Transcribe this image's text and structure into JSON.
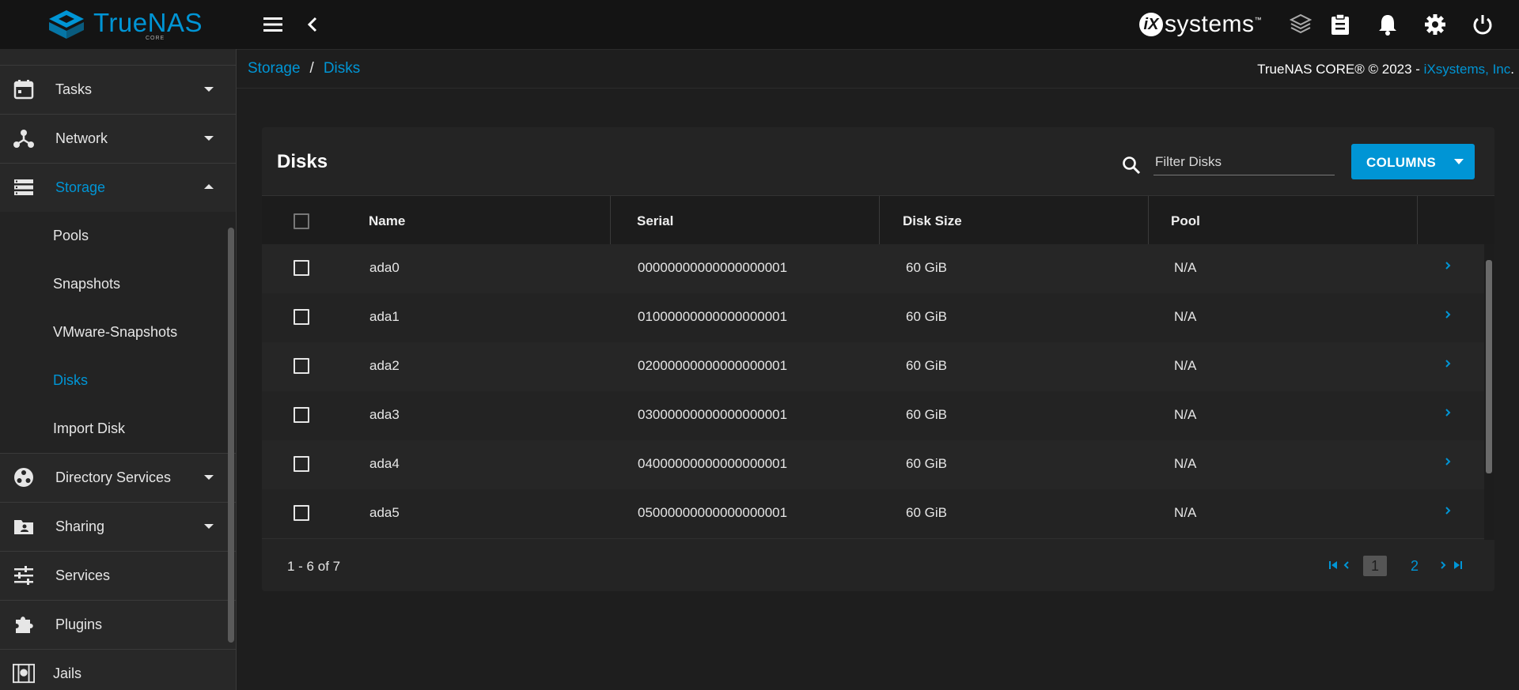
{
  "app": {
    "logo_text": "TrueNAS",
    "logo_sub": "CORE",
    "vendor_logo_mark": "iX",
    "vendor_logo_text": "systems",
    "vendor_logo_tm": "™"
  },
  "topbar": {
    "icons": [
      "menu-icon",
      "back-arrow-icon",
      "truecommand-icon",
      "clipboard-icon",
      "bell-icon",
      "gear-icon",
      "power-icon"
    ]
  },
  "sidebar": {
    "items": [
      {
        "label": "Tasks",
        "icon": "calendar-icon"
      },
      {
        "label": "Network",
        "icon": "network-icon"
      },
      {
        "label": "Storage",
        "icon": "storage-icon"
      },
      {
        "label": "Directory Services",
        "icon": "directory-icon"
      },
      {
        "label": "Sharing",
        "icon": "share-folder-icon"
      },
      {
        "label": "Services",
        "icon": "sliders-icon"
      },
      {
        "label": "Plugins",
        "icon": "puzzle-icon"
      },
      {
        "label": "Jails",
        "icon": "jail-icon"
      }
    ],
    "storage_sub": [
      {
        "label": "Pools"
      },
      {
        "label": "Snapshots"
      },
      {
        "label": "VMware-Snapshots"
      },
      {
        "label": "Disks"
      },
      {
        "label": "Import Disk"
      }
    ]
  },
  "breadcrumb": {
    "parent": "Storage",
    "separator": "/",
    "current": "Disks"
  },
  "copyright": {
    "text": "TrueNAS CORE® © 2023 - ",
    "link": "iXsystems, Inc",
    "suffix": "."
  },
  "card": {
    "title": "Disks",
    "filter_placeholder": "Filter Disks",
    "columns_button": "COLUMNS"
  },
  "table": {
    "headers": [
      "Name",
      "Serial",
      "Disk Size",
      "Pool"
    ],
    "rows": [
      {
        "name": "ada0",
        "serial": "00000000000000000001",
        "size": "60 GiB",
        "pool": "N/A"
      },
      {
        "name": "ada1",
        "serial": "01000000000000000001",
        "size": "60 GiB",
        "pool": "N/A"
      },
      {
        "name": "ada2",
        "serial": "02000000000000000001",
        "size": "60 GiB",
        "pool": "N/A"
      },
      {
        "name": "ada3",
        "serial": "03000000000000000001",
        "size": "60 GiB",
        "pool": "N/A"
      },
      {
        "name": "ada4",
        "serial": "04000000000000000001",
        "size": "60 GiB",
        "pool": "N/A"
      },
      {
        "name": "ada5",
        "serial": "05000000000000000001",
        "size": "60 GiB",
        "pool": "N/A"
      }
    ]
  },
  "pagination": {
    "range_text": "1 - 6 of 7",
    "pages": [
      "1",
      "2"
    ],
    "current_page": "1"
  },
  "colors": {
    "accent": "#0095d5",
    "topbar_bg": "#141414",
    "sidebar_bg": "#282828",
    "content_bg": "#1e1e1e"
  }
}
